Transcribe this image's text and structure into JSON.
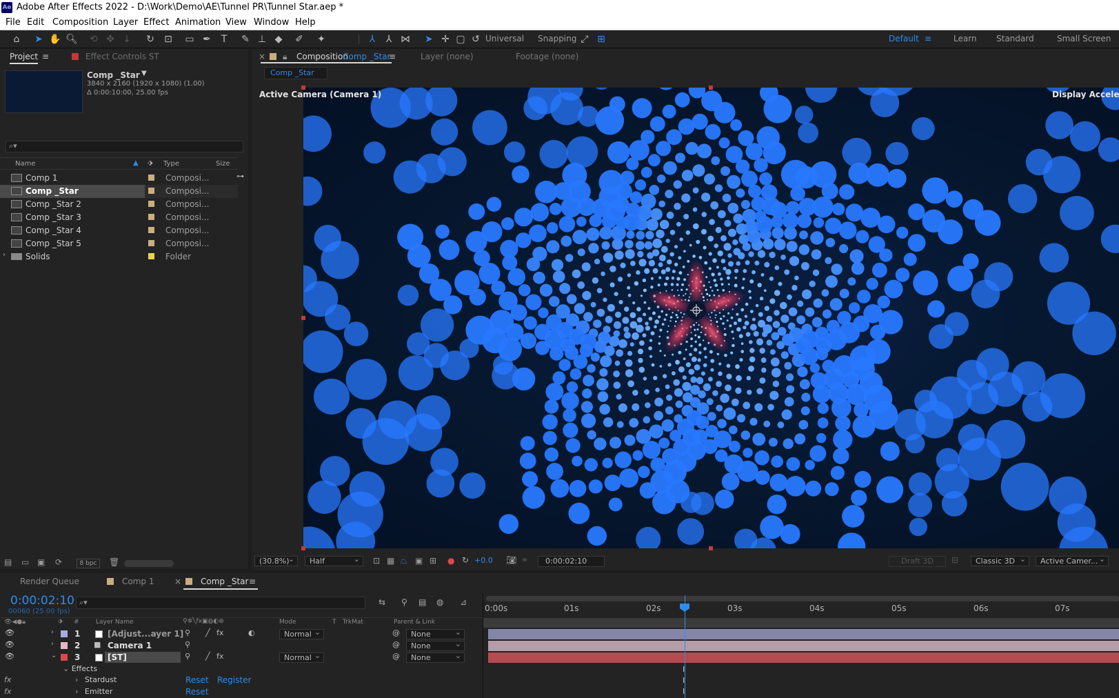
{
  "app": {
    "icon": "Ae",
    "title": "Adobe After Effects 2022 - D:\\Work\\Demo\\AE\\Tunnel PR\\Tunnel Star.aep *"
  },
  "menu": [
    "File",
    "Edit",
    "Composition",
    "Layer",
    "Effect",
    "Animation",
    "View",
    "Window",
    "Help"
  ],
  "toolbar": {
    "universal": "Universal",
    "snapping": "Snapping",
    "workspaces": [
      "Default",
      "Learn",
      "Standard",
      "Small Screen"
    ],
    "active_workspace": "Default"
  },
  "project": {
    "tab": "Project",
    "effect_tab": "Effect Controls ST",
    "comp_name": "Comp _Star",
    "comp_res": "3840 x 2160  (1920 x 1080) (1.00)",
    "comp_dur": "Δ 0:00:10:00, 25.00 fps",
    "search_placeholder": "",
    "columns": {
      "name": "Name",
      "type": "Type",
      "size": "Size"
    },
    "items": [
      {
        "name": "Comp 1",
        "type": "Composi...",
        "label": "#c9ae7e",
        "kind": "comp"
      },
      {
        "name": "Comp _Star",
        "type": "Composi...",
        "label": "#c9ae7e",
        "kind": "comp",
        "selected": true
      },
      {
        "name": "Comp _Star 2",
        "type": "Composi...",
        "label": "#c9ae7e",
        "kind": "comp"
      },
      {
        "name": "Comp _Star 3",
        "type": "Composi...",
        "label": "#c9ae7e",
        "kind": "comp"
      },
      {
        "name": "Comp _Star 4",
        "type": "Composi...",
        "label": "#c9ae7e",
        "kind": "comp"
      },
      {
        "name": "Comp _Star 5",
        "type": "Composi...",
        "label": "#c9ae7e",
        "kind": "comp"
      },
      {
        "name": "Solids",
        "type": "Folder",
        "label": "#e9d54d",
        "kind": "folder"
      }
    ],
    "bpc": "8 bpc"
  },
  "composition": {
    "tab_prefix": "Composition",
    "tab_name": "Comp _Star",
    "layer_tab": "Layer (none)",
    "footage_tab": "Footage (none)",
    "sub_tab": "Comp _Star",
    "camera_label": "Active Camera (Camera 1)",
    "accel_label": "Display Acceleration",
    "zoom": "(30.8%)",
    "resolution": "Half",
    "exposure": "+0.0",
    "timecode": "0:00:02:10",
    "draft": "Draft 3D",
    "renderer": "Classic 3D",
    "view": "Active Camer..."
  },
  "timeline": {
    "tabs": [
      "Render Queue",
      "Comp 1",
      "Comp _Star"
    ],
    "active_tab": "Comp _Star",
    "timecode": "0:00:02:10",
    "frame_info": "00060 (25.00 fps)",
    "headers": {
      "num": "#",
      "layer_name": "Layer Name",
      "mode": "Mode",
      "t": "T",
      "trkmat": "TrkMat",
      "parent": "Parent & Link"
    },
    "layers": [
      {
        "num": "1",
        "name": "[Adjust...ayer 1]",
        "mode": "Normal",
        "parent": "None",
        "label": "#a9a9e1",
        "bar": "#8484a8"
      },
      {
        "num": "2",
        "name": "Camera 1",
        "mode": "",
        "parent": "None",
        "label": "#e4b6c6",
        "bar": "#b39ca7"
      },
      {
        "num": "3",
        "name": "[ST]",
        "mode": "Normal",
        "parent": "None",
        "label": "#e04848",
        "bar": "#b54b52"
      }
    ],
    "effects_label": "Effects",
    "effects": [
      {
        "name": "Stardust",
        "reset": "Reset",
        "register": "Register"
      },
      {
        "name": "Emitter",
        "reset": "Reset"
      }
    ],
    "ruler": [
      "0:00s",
      "01s",
      "02s",
      "03s",
      "04s",
      "05s",
      "06s",
      "07s"
    ]
  },
  "colors": {
    "accent": "#2d8ceb",
    "panel": "#232323",
    "bg": "#1d1d1d",
    "viewer_bg": "#061428",
    "particle_blue": "#1f6dff",
    "core_red": "#ff2b4a"
  }
}
